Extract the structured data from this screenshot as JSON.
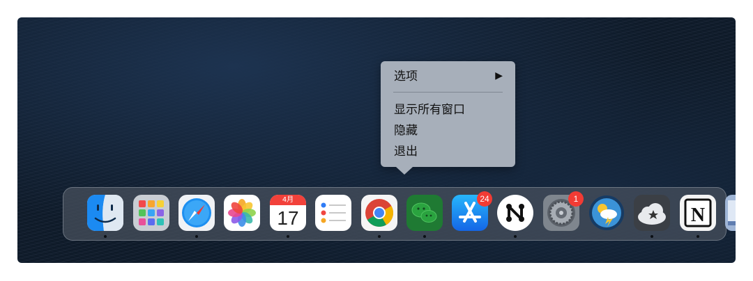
{
  "context_menu": {
    "items": [
      {
        "label": "选项",
        "has_submenu": true
      },
      {
        "label": "显示所有窗口"
      },
      {
        "label": "隐藏"
      },
      {
        "label": "退出"
      }
    ],
    "submenu_arrow": "▶"
  },
  "dock": {
    "apps": [
      {
        "name": "finder-icon",
        "running": true
      },
      {
        "name": "launchpad-icon",
        "running": false
      },
      {
        "name": "safari-icon",
        "running": true
      },
      {
        "name": "photos-icon",
        "running": false
      },
      {
        "name": "calendar-icon",
        "running": true,
        "month": "4月",
        "day": "17"
      },
      {
        "name": "reminders-icon",
        "running": false
      },
      {
        "name": "chrome-icon",
        "running": true
      },
      {
        "name": "wechat-icon",
        "running": true
      },
      {
        "name": "app-store-icon",
        "running": false,
        "badge": "24"
      },
      {
        "name": "nova-app-icon",
        "running": true
      },
      {
        "name": "system-preferences-icon",
        "running": false,
        "badge": "1"
      },
      {
        "name": "weather-icon",
        "running": false
      },
      {
        "name": "cloud-star-icon",
        "running": true
      },
      {
        "name": "notion-icon",
        "running": true
      },
      {
        "name": "preview-icon",
        "running": false
      }
    ]
  },
  "colors": {
    "menu_bg": "#a7afba",
    "badge": "#f23b34",
    "wechat": "#1f7a33"
  }
}
